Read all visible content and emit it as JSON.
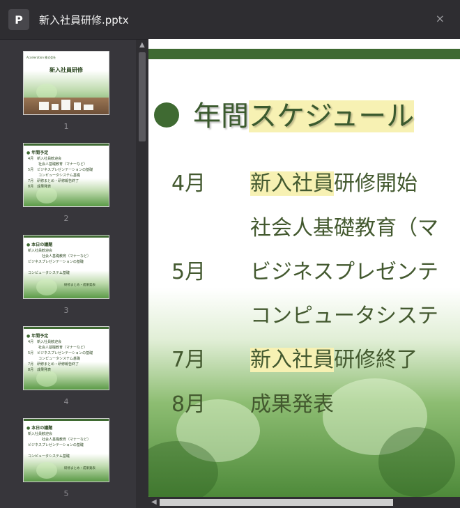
{
  "window": {
    "app_icon_letter": "P",
    "title": "新入社員研修.pptx",
    "close_symbol": "×"
  },
  "thumbnails": [
    {
      "number": "1",
      "company": "Acceleration 株式会社",
      "title": "新入社員研修"
    },
    {
      "number": "2",
      "heading": "年間予定",
      "lines": [
        "4月　新入社員歓迎会",
        "　　　社会人基礎教育（マナーなど）",
        "5月　ビジネスプレゼンテーションの基礎",
        "　　　コンピュータシステム基礎",
        "7月　研修まとめ・研修報告終了",
        "8月　成果発表"
      ]
    },
    {
      "number": "3",
      "heading": "本日の議題",
      "lines": [
        "新入社員歓迎会",
        "　　　　社会人基礎教育（マナーなど）",
        "ビジネスプレゼンテーションの基礎",
        "コンピュータシステム基礎"
      ],
      "footer": "研修まとめ・成果発表"
    },
    {
      "number": "4",
      "heading": "年間予定",
      "lines": [
        "4月　新入社員歓迎会",
        "　　　社会人基礎教育（マナーなど）",
        "5月　ビジネスプレゼンテーションの基礎",
        "　　　コンピュータシステム基礎",
        "7月　研修まとめ・研修報告終了",
        "8月　成果発表"
      ]
    },
    {
      "number": "5",
      "heading": "本日の議題",
      "lines": [
        "新入社員歓迎会",
        "　　　　社会人基礎教育（マナーなど）",
        "ビジネスプレゼンテーションの基礎",
        "コンピュータシステム基礎"
      ],
      "footer": "研修まとめ・成果発表"
    }
  ],
  "slide": {
    "title_plain": "年間",
    "title_highlight": "スケジュール",
    "rows": [
      {
        "month": "4月",
        "hl": "新入社員",
        "rest": "研修開始"
      },
      {
        "month": "",
        "hl": "",
        "rest": "社会人基礎教育（マ"
      },
      {
        "month": "5月",
        "hl": "",
        "rest": "ビジネスプレゼンテ"
      },
      {
        "month": "",
        "hl": "",
        "rest": "コンピュータシステ"
      },
      {
        "month": "7月",
        "hl": "新入社員",
        "rest": "研修終了"
      },
      {
        "month": "8月",
        "hl": "",
        "rest": "成果発表"
      }
    ]
  },
  "colors": {
    "accent_green": "#3f6a32",
    "highlight_yellow": "#f7f1b3"
  }
}
